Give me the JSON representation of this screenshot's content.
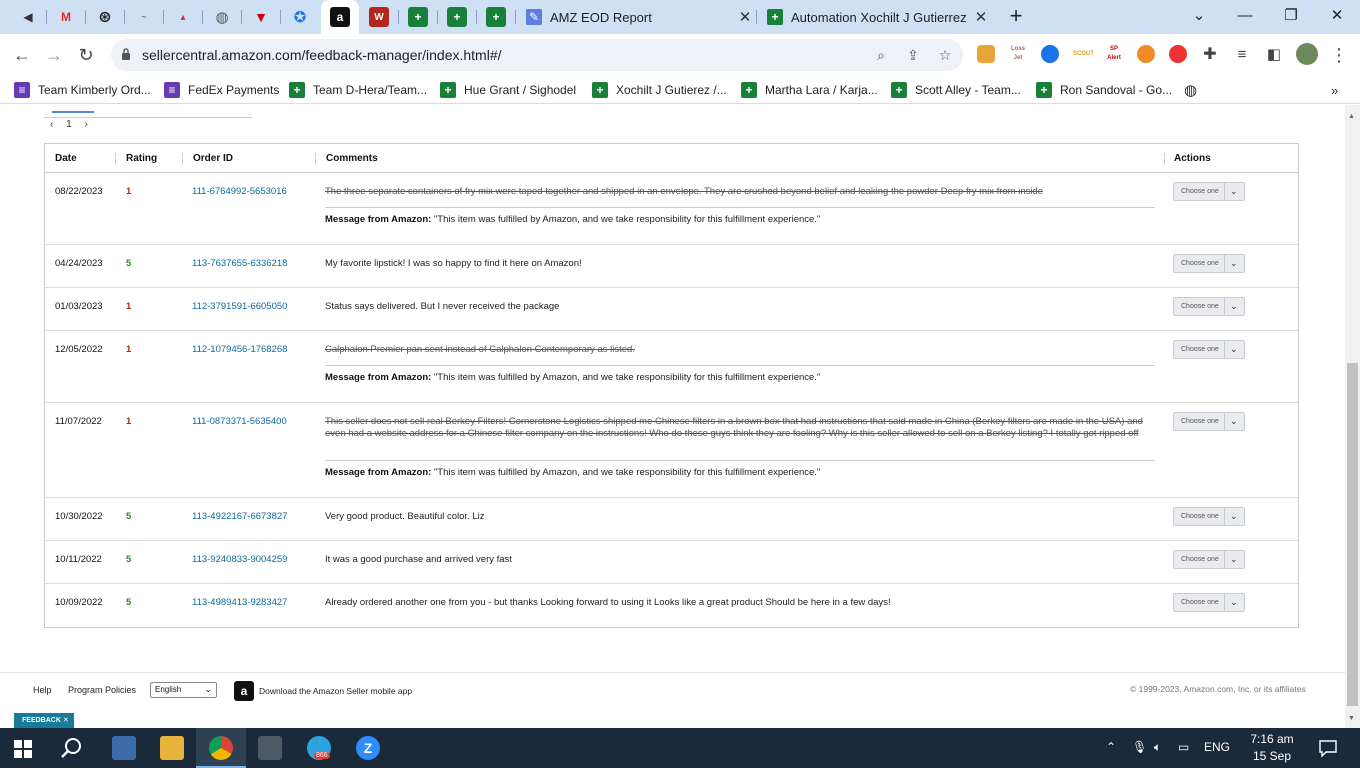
{
  "browser": {
    "tabs": [
      {
        "title": "AMZ EOD Report"
      },
      {
        "title": "Automation Xochilt J Gutierrez (C"
      }
    ],
    "url": "sellercentral.amazon.com/feedback-manager/index.html#/",
    "bookmarks": [
      {
        "label": "Team Kimberly Ord..."
      },
      {
        "label": "FedEx Payments"
      },
      {
        "label": "Team D-Hera/Team..."
      },
      {
        "label": "Hue Grant / Sighodel"
      },
      {
        "label": "Xochilt J Gutierez /..."
      },
      {
        "label": "Martha Lara / Karja..."
      },
      {
        "label": "Scott Alley - Team..."
      },
      {
        "label": "Ron Sandoval - Go..."
      }
    ],
    "extensions": [
      {
        "text": "Loss Jet"
      },
      {
        "text": "SCOUT"
      },
      {
        "text": "SP Alert"
      }
    ]
  },
  "pager": {
    "current": "1"
  },
  "table": {
    "headers": {
      "date": "Date",
      "rating": "Rating",
      "order_id": "Order ID",
      "comments": "Comments",
      "actions": "Actions"
    },
    "action_label": "Choose one",
    "message_label": "Message from Amazon:",
    "message_text": "\"This item was fulfilled by Amazon, and we take responsibility for this fulfillment experience.\"",
    "rows": [
      {
        "date": "08/22/2023",
        "rating": "1",
        "order_id": "111-6764992-5653016",
        "comment": "The three separate containers of fry mix were taped together and shipped in an envelope. They are crushed beyond belief and leaking the powder Deep fry mix from inside"
      },
      {
        "date": "04/24/2023",
        "rating": "5",
        "order_id": "113-7637655-6336218",
        "comment": "My favorite lipstick! I was so happy to find it here on Amazon!"
      },
      {
        "date": "01/03/2023",
        "rating": "1",
        "order_id": "112-3791591-6605050",
        "comment": "Status says delivered. But I never received the package"
      },
      {
        "date": "12/05/2022",
        "rating": "1",
        "order_id": "112-1079456-1768268",
        "comment": "Calphalon Premier pan sent instead of Calphalon Contemporary as listed."
      },
      {
        "date": "11/07/2022",
        "rating": "1",
        "order_id": "111-0873371-5635400",
        "comment": "This seller does not sell real Berkey Filters! Cornerstone Logistics shipped me Chinese filters in a brown box that had instructions that said made in China (Berkey filters are made in the USA) and even had a website address for a Chinese filter company on the instructions! Who do these guys think they are fooling? Why is this seller allowed to sell on a Berkey listing? I totally got ripped off"
      },
      {
        "date": "10/30/2022",
        "rating": "5",
        "order_id": "113-4922167-6673827",
        "comment": "Very good product. Beautiful color. Liz"
      },
      {
        "date": "10/11/2022",
        "rating": "5",
        "order_id": "113-9240833-9004259",
        "comment": "It was a good purchase and arrived very fast"
      },
      {
        "date": "10/09/2022",
        "rating": "5",
        "order_id": "113-4989413-9283427",
        "comment": "Already ordered another one from you - but thanks Looking forward to using it Looks like a great product Should be here in a few days!"
      }
    ]
  },
  "footer": {
    "help": "Help",
    "policies": "Program Policies",
    "language": "English",
    "app_text": "Download the Amazon Seller mobile app",
    "copyright": "© 1999-2023, Amazon.com, Inc. or its affiliates",
    "feedback": "FEEDBACK"
  },
  "taskbar": {
    "badge": "866",
    "language": "ENG",
    "time": "7:16 am",
    "date": "15 Sep 2023"
  },
  "colors": {
    "tabstrip": "#cfe0f5",
    "link": "#0a6aa1",
    "rating_low": "#b12704",
    "rating_high": "#2a8a2a",
    "taskbar": "#1b2a3a"
  }
}
